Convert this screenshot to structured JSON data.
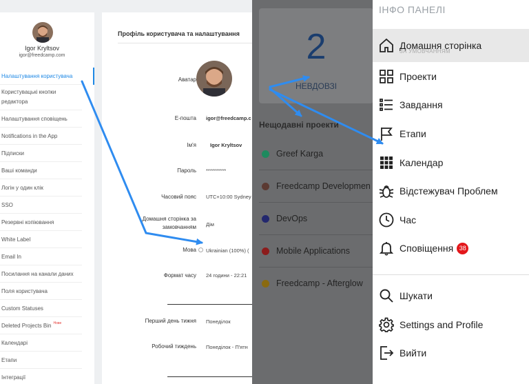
{
  "profile": {
    "name": "Igor Kryltsov",
    "email": "igor@freedcamp.com"
  },
  "settings_menu": [
    {
      "label": "Налаштування користувача"
    },
    {
      "label": "Користувацькі кнопки редактора"
    },
    {
      "label": "Налаштування сповіщень"
    },
    {
      "label": "Notifications in the App"
    },
    {
      "label": "Підписки"
    },
    {
      "label": "Ваші команди"
    },
    {
      "label": "Логін у один клік"
    },
    {
      "label": "SSO"
    },
    {
      "label": "Резервні копіювання"
    },
    {
      "label": "White Label"
    },
    {
      "label": "Email In"
    },
    {
      "label": "Посилання на канали даних"
    },
    {
      "label": "Поля користувача"
    },
    {
      "label": "Custom Statuses"
    },
    {
      "label": "Deleted Projects Bin",
      "badge": "Нове"
    },
    {
      "label": "Календарі"
    },
    {
      "label": "Етапи"
    },
    {
      "label": "Інтеграції"
    }
  ],
  "profile_card": {
    "title": "Профіль користувача та налаштування",
    "avatar_label": "Аватар",
    "email_label": "E-пошта",
    "email_value": "igor@freedcamp.c",
    "name_label": "Ім'я",
    "name_value": "Igor Kryltsov",
    "password_label": "Пароль",
    "password_value": "**********",
    "timezone_label": "Часовий пояс",
    "timezone_value": "UTC+10:00 Sydney",
    "homepage_label": "Домашня сторінка за замовчанням",
    "homepage_value": "Дім",
    "language_label": "Мова",
    "language_value": "Ukrainian (100%) (",
    "timeformat_label": "Формат часу",
    "timeformat_value": "24 години - 22:21",
    "firstday_label": "Перший день тижня",
    "firstday_value": "Понеділок",
    "workweek_label": "Робочий тиждень",
    "workweek_value": "Понеділок - П'ятн"
  },
  "dashboard": {
    "count": "2",
    "later_label": "НЕВДОВЗІ",
    "recent_title": "Нещодавні проекти",
    "projects": [
      {
        "name": "Greef Karga",
        "color": "#1e8a5e"
      },
      {
        "name": "Freedcamp Developmen",
        "color": "#5b3a32"
      },
      {
        "name": "DevOps",
        "color": "#23286e"
      },
      {
        "name": "Mobile Applications",
        "color": "#8c1c1c"
      },
      {
        "name": "Freedcamp - Afterglow",
        "color": "#8a6a10"
      }
    ]
  },
  "nav": {
    "header": "ІНФО ПАНЕЛІ",
    "items": [
      {
        "label": "Домашня сторінка",
        "sub": "ЗА УМОВЧАННЯМ",
        "icon": "home-icon"
      },
      {
        "label": "Проекти",
        "icon": "projects-grid-icon"
      },
      {
        "label": "Завдання",
        "icon": "tasks-list-icon"
      },
      {
        "label": "Етапи",
        "icon": "flag-icon"
      },
      {
        "label": "Календар",
        "icon": "calendar-grid-icon"
      },
      {
        "label": "Відстежувач Проблем",
        "icon": "bug-icon"
      },
      {
        "label": "Час",
        "icon": "clock-icon"
      },
      {
        "label": "Сповіщення",
        "badge": "38",
        "icon": "bell-icon"
      },
      {
        "label": "Шукати",
        "icon": "search-icon"
      },
      {
        "label": "Settings and Profile",
        "icon": "gear-icon"
      },
      {
        "label": "Вийти",
        "icon": "logout-icon"
      }
    ]
  },
  "colors": {
    "accent": "#1e88e5",
    "badge": "#e3171b",
    "arrow": "#2f8cf0"
  }
}
